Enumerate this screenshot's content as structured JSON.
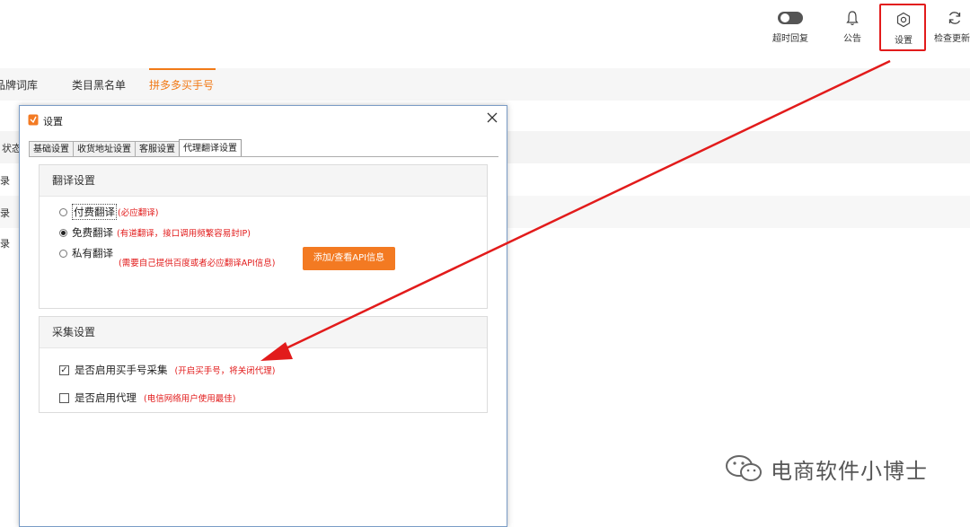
{
  "toolbar": {
    "timeout_reply_label": "超时回复",
    "notice_label": "公告",
    "settings_label": "设置",
    "check_update_label": "检查更新"
  },
  "background": {
    "tabs": [
      "品牌词库",
      "类目黑名单",
      "拼多多买手号"
    ],
    "active_tab": "拼多多买手号",
    "column_header": "状态",
    "row_cells": [
      "录",
      "录",
      "录"
    ]
  },
  "dialog": {
    "title": "设置",
    "tabs": [
      "基础设置",
      "收货地址设置",
      "客服设置",
      "代理翻译设置"
    ],
    "active_tab": "代理翻译设置",
    "translation": {
      "heading": "翻译设置",
      "options": [
        {
          "label": "付费翻译",
          "hint": "(必应翻译)",
          "selected": false
        },
        {
          "label": "免费翻译",
          "hint": "(有道翻译，接口调用频繁容易封IP)",
          "selected": true
        },
        {
          "label": "私有翻译",
          "hint": "(需要自己提供百度或者必应翻译API信息)",
          "selected": false
        }
      ],
      "api_button_label": "添加/查看API信息"
    },
    "collect": {
      "heading": "采集设置",
      "options": [
        {
          "label": "是否启用买手号采集",
          "hint": "(开启买手号，将关闭代理)",
          "checked": true
        },
        {
          "label": "是否启用代理",
          "hint": "(电信网络用户使用最佳)",
          "checked": false
        }
      ]
    }
  },
  "watermark": {
    "text": "电商软件小博士"
  },
  "colors": {
    "accent": "#f17a17",
    "highlight_red": "#e21b1b",
    "button_orange": "#f37a22"
  }
}
